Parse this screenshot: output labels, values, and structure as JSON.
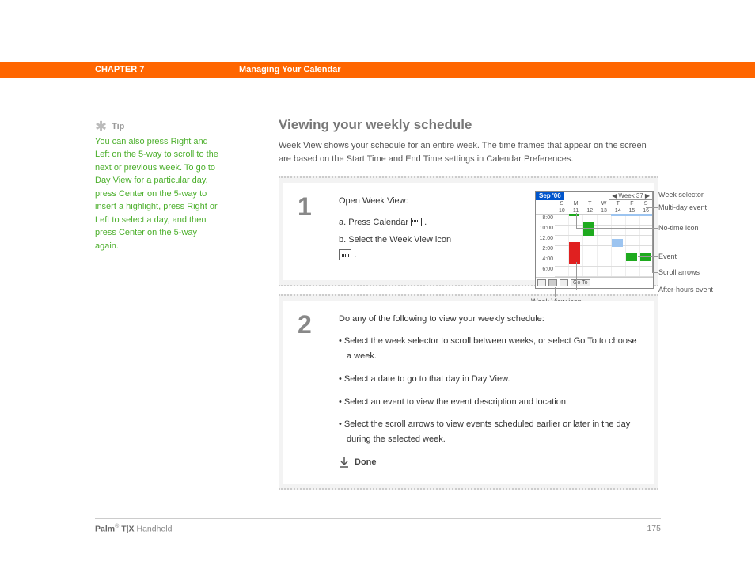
{
  "header": {
    "chapter": "CHAPTER 7",
    "title": "Managing Your Calendar"
  },
  "tip": {
    "label": "Tip",
    "body": "You can also press Right and Left on the 5-way to scroll to the next or previous week. To go to Day View for a particular day, press Center on the 5-way to insert a highlight, press Right or Left to select a day, and then press Center on the 5-way again."
  },
  "section": {
    "heading": "Viewing your weekly schedule",
    "intro": "Week View shows your schedule for an entire week. The time frames that appear on the screen are based on the Start Time and End Time settings in Calendar Preferences."
  },
  "step1": {
    "num": "1",
    "lead": "Open Week View:",
    "a_prefix": "a.  Press Calendar ",
    "a_suffix": ".",
    "b_prefix": "b.  Select the Week View icon",
    "b_suffix": "."
  },
  "step2": {
    "num": "2",
    "lead": "Do any of the following to view your weekly schedule:",
    "items": [
      "Select the week selector to scroll between weeks, or select Go To to choose a week.",
      "Select a date to go to that day in Day View.",
      "Select an event to view the event description and location.",
      "Select the scroll arrows to view events scheduled earlier or later in the day during the selected week."
    ],
    "done": "Done"
  },
  "weekview": {
    "month": "Sep '06",
    "week_label": "Week 37",
    "day_letters": [
      "S",
      "M",
      "T",
      "W",
      "T",
      "F",
      "S"
    ],
    "day_nums": [
      "10",
      "11",
      "12",
      "13",
      "14",
      "15",
      "16"
    ],
    "times": [
      "8:00",
      "10:00",
      "12:00",
      "2:00",
      "4:00",
      "6:00"
    ],
    "goto": "Go To",
    "callouts": {
      "week_selector": "Week selector",
      "multiday": "Multi-day event",
      "notime": "No-time icon",
      "event": "Event",
      "scroll": "Scroll arrows",
      "afterhours": "After-hours event",
      "weekview_icon": "Week View icon"
    }
  },
  "footer": {
    "brand_prefix": "Palm",
    "brand_model": "T|X",
    "brand_suffix": "Handheld",
    "page": "175"
  }
}
